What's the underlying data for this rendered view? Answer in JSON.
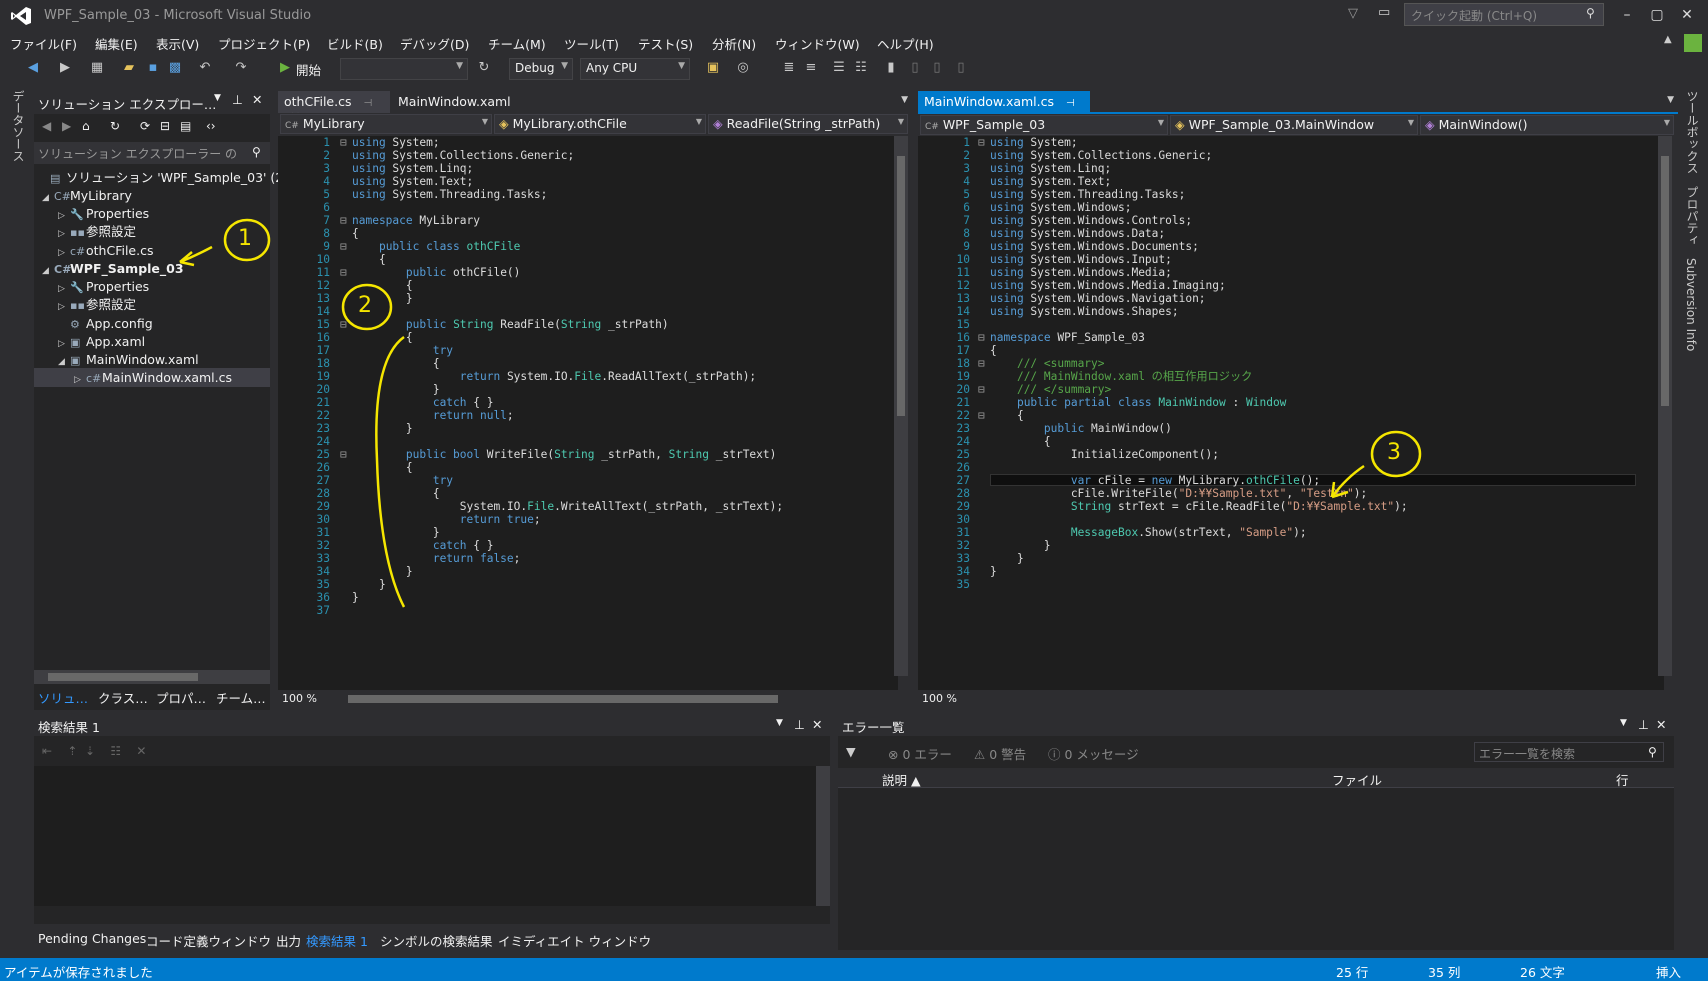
{
  "window": {
    "title": "WPF_Sample_03 - Microsoft Visual Studio",
    "quick_launch_placeholder": "クイック起動 (Ctrl+Q)"
  },
  "menu": [
    "ファイル(F)",
    "編集(E)",
    "表示(V)",
    "プロジェクト(P)",
    "ビルド(B)",
    "デバッグ(D)",
    "チーム(M)",
    "ツール(T)",
    "テスト(S)",
    "分析(N)",
    "ウィンドウ(W)",
    "ヘルプ(H)"
  ],
  "toolbar": {
    "start_label": "開始",
    "config": "Debug",
    "platform": "Any CPU"
  },
  "left_sidetab": "データソース",
  "right_sidetabs": [
    "ツールボックス",
    "プロパティ",
    "Subversion Info"
  ],
  "solution_explorer": {
    "title": "ソリューション エクスプロー…",
    "search_placeholder": "ソリューション エクスプローラー の",
    "items": [
      {
        "label": "ソリューション 'WPF_Sample_03' (2"
      },
      {
        "label": "MyLibrary"
      },
      {
        "label": "Properties"
      },
      {
        "label": "参照設定"
      },
      {
        "label": "othCFile.cs"
      },
      {
        "label": "WPF_Sample_03"
      },
      {
        "label": "Properties"
      },
      {
        "label": "参照設定"
      },
      {
        "label": "App.config"
      },
      {
        "label": "App.xaml"
      },
      {
        "label": "MainWindow.xaml"
      },
      {
        "label": "MainWindow.xaml.cs"
      }
    ],
    "tabs": [
      "ソリュ…",
      "クラス…",
      "プロパ…",
      "チーム…"
    ]
  },
  "editor_left": {
    "tabs": [
      "othCFile.cs",
      "MainWindow.xaml"
    ],
    "nav": [
      "MyLibrary",
      "MyLibrary.othCFile",
      "ReadFile(String _strPath)"
    ],
    "zoom": "100 %"
  },
  "editor_right": {
    "tabs": [
      "MainWindow.xaml.cs"
    ],
    "nav": [
      "WPF_Sample_03",
      "WPF_Sample_03.MainWindow",
      "MainWindow()"
    ],
    "zoom": "100 %"
  },
  "search_results": {
    "title": "検索結果 1",
    "bottom_tabs": [
      "Pending Changes",
      "コード定義ウィンドウ",
      "出力",
      "検索結果 1",
      "シンボルの検索結果",
      "イミディエイト ウィンドウ"
    ]
  },
  "error_list": {
    "title": "エラー一覧",
    "errors": "0 エラー",
    "warnings": "0 警告",
    "messages": "0 メッセージ",
    "search_placeholder": "エラー一覧を検索",
    "columns": [
      "説明",
      "ファイル",
      "行"
    ]
  },
  "annotations": [
    "1",
    "2",
    "3"
  ],
  "status": {
    "message": "アイテムが保存されました",
    "line": "25 行",
    "col": "35 列",
    "chars": "26 文字",
    "mode": "挿入"
  }
}
